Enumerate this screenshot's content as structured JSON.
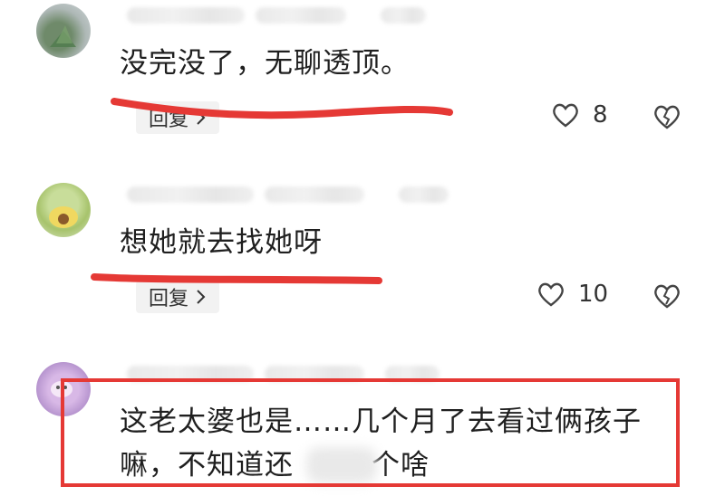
{
  "comments": [
    {
      "text": "没完没了，无聊透顶。",
      "reply_label": "回复",
      "likes": "8"
    },
    {
      "text": "想她就去找她呀",
      "reply_label": "回复",
      "likes": "10"
    },
    {
      "text_line1": "这老太婆也是……几个月了去看过俩孩子",
      "text_line2_a": "嘛，不知道还",
      "text_line2_b": "个啥"
    }
  ],
  "icons": {
    "like": "heart-outline-icon",
    "dislike": "broken-heart-icon",
    "chevron": "chevron-right-icon"
  },
  "colors": {
    "annotation_red": "#e53935"
  }
}
